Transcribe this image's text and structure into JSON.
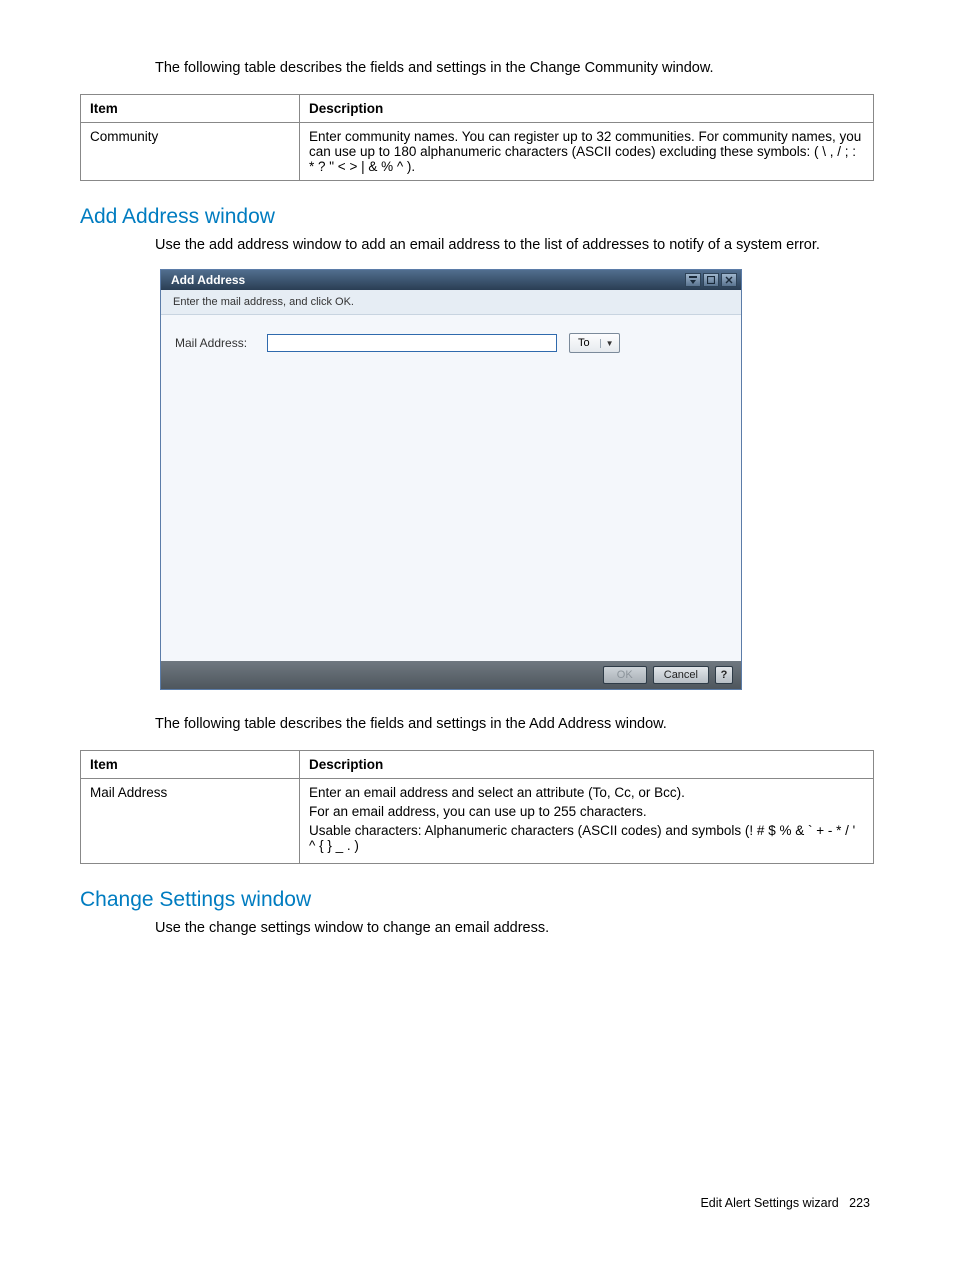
{
  "intro1": "The following table describes the fields and settings in the Change Community window.",
  "table1": {
    "head_item": "Item",
    "head_desc": "Description",
    "row_item": "Community",
    "row_desc": "Enter community names. You can register up to 32 communities. For community names, you can use up to 180 alphanumeric characters (ASCII codes) excluding these symbols: ( \\ , / ; : * ? \" < > | & % ^ )."
  },
  "heading_add": "Add Address window",
  "text_add": "Use the add address window to add an email address to the list of addresses to notify of a system error.",
  "dialog": {
    "title": "Add Address",
    "subhead": "Enter the mail address, and click OK.",
    "label": "Mail Address:",
    "dropdown_value": "To",
    "ok": "OK",
    "cancel": "Cancel",
    "help": "?"
  },
  "intro2": "The following table describes the fields and settings in the Add Address window.",
  "table2": {
    "head_item": "Item",
    "head_desc": "Description",
    "row_item": "Mail Address",
    "desc_line1": "Enter an email address and select an attribute (To, Cc, or Bcc).",
    "desc_line2": "For an email address, you can use up to 255 characters.",
    "desc_line3": "Usable characters: Alphanumeric characters (ASCII codes) and symbols (! # $ % & ` + - * / ' ^ { } _ . )"
  },
  "heading_change": "Change Settings window",
  "text_change": "Use the change settings window to change an email address.",
  "footer_text": "Edit Alert Settings wizard",
  "footer_page": "223"
}
